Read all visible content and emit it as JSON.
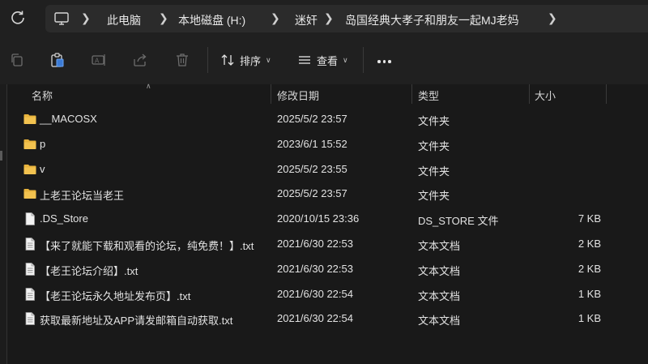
{
  "breadcrumb": {
    "items": [
      "此电脑",
      "本地磁盘 (H:)",
      "迷奸",
      "岛国经典大孝子和朋友一起MJ老妈"
    ]
  },
  "toolbar": {
    "sort_label": "排序",
    "view_label": "查看"
  },
  "columns": {
    "name": "名称",
    "modified": "修改日期",
    "type": "类型",
    "size": "大小"
  },
  "files": [
    {
      "name": "__MACOSX",
      "modified": "2025/5/2 23:57",
      "type": "文件夹",
      "size": "",
      "icon": "folder-icon"
    },
    {
      "name": "p",
      "modified": "2023/6/1 15:52",
      "type": "文件夹",
      "size": "",
      "icon": "folder-icon"
    },
    {
      "name": "v",
      "modified": "2025/5/2 23:55",
      "type": "文件夹",
      "size": "",
      "icon": "folder-icon"
    },
    {
      "name": "上老王论坛当老王",
      "modified": "2025/5/2 23:57",
      "type": "文件夹",
      "size": "",
      "icon": "folder-icon"
    },
    {
      "name": ".DS_Store",
      "modified": "2020/10/15 23:36",
      "type": "DS_STORE 文件",
      "size": "7 KB",
      "icon": "file-icon"
    },
    {
      "name": "【来了就能下载和观看的论坛，纯免费！】.txt",
      "modified": "2021/6/30 22:53",
      "type": "文本文档",
      "size": "2 KB",
      "icon": "text-file-icon"
    },
    {
      "name": "【老王论坛介绍】.txt",
      "modified": "2021/6/30 22:53",
      "type": "文本文档",
      "size": "2 KB",
      "icon": "text-file-icon"
    },
    {
      "name": "【老王论坛永久地址发布页】.txt",
      "modified": "2021/6/30 22:54",
      "type": "文本文档",
      "size": "1 KB",
      "icon": "text-file-icon"
    },
    {
      "name": "获取最新地址及APP请发邮箱自动获取.txt",
      "modified": "2021/6/30 22:54",
      "type": "文本文档",
      "size": "1 KB",
      "icon": "text-file-icon"
    }
  ],
  "colors": {
    "folder": "#e8b33c",
    "background": "#191919",
    "toolbar": "#202020"
  }
}
